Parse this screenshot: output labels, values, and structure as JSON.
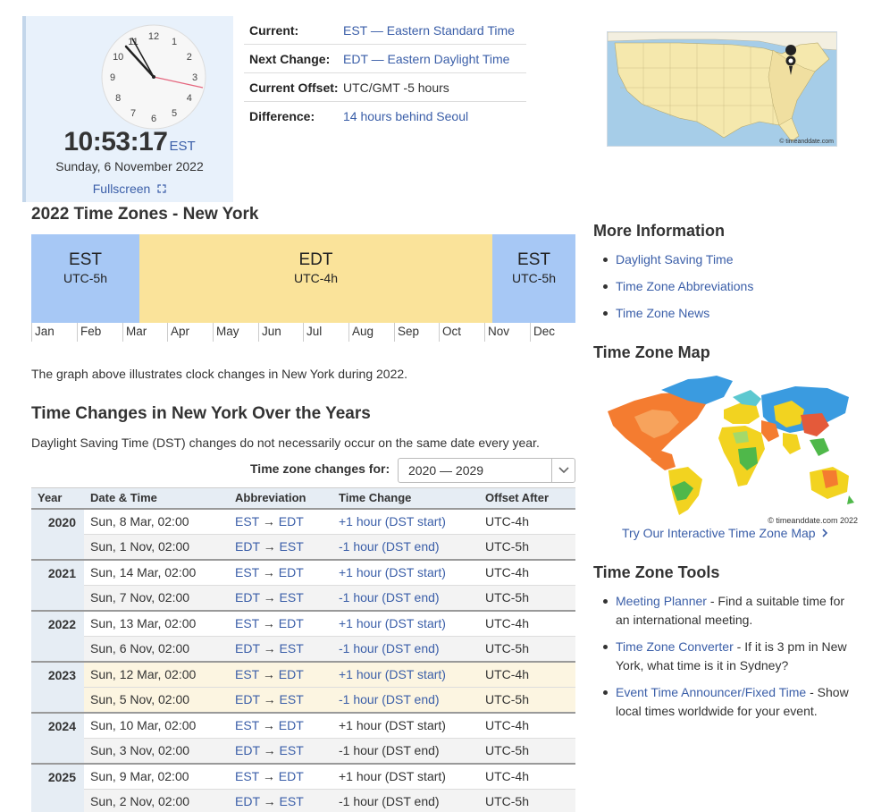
{
  "clock": {
    "time": "10:53:17",
    "zone": "EST",
    "date": "Sunday, 6 November 2022",
    "fullscreen_label": "Fullscreen",
    "numerals": [
      "12",
      "1",
      "2",
      "3",
      "4",
      "5",
      "6",
      "7",
      "8",
      "9",
      "10",
      "11"
    ]
  },
  "info": {
    "rows": [
      {
        "label": "Current:",
        "value": "EST — Eastern Standard Time"
      },
      {
        "label": "Next Change:",
        "value": "EDT — Eastern Daylight Time"
      },
      {
        "label": "Current Offset:",
        "value": "UTC/GMT -5 hours"
      },
      {
        "label": "Difference:",
        "value": "14 hours behind Seoul"
      }
    ]
  },
  "small_map": {
    "copyright": "© timeanddate.com"
  },
  "timezones": {
    "heading": "2022 Time Zones - New York",
    "blocks": [
      {
        "abbr": "EST",
        "offset": "UTC-5h"
      },
      {
        "abbr": "EDT",
        "offset": "UTC-4h"
      },
      {
        "abbr": "EST",
        "offset": "UTC-5h"
      }
    ],
    "months": [
      "Jan",
      "Feb",
      "Mar",
      "Apr",
      "May",
      "Jun",
      "Jul",
      "Aug",
      "Sep",
      "Oct",
      "Nov",
      "Dec"
    ],
    "note": "The graph above illustrates clock changes in New York during 2022."
  },
  "changes": {
    "heading": "Time Changes in New York Over the Years",
    "note": "Daylight Saving Time (DST) changes do not necessarily occur on the same date every year.",
    "select_label": "Time zone changes for:",
    "select_value": "2020 — 2029",
    "columns": [
      "Year",
      "Date & Time",
      "Abbreviation",
      "Time Change",
      "Offset After"
    ],
    "rows": [
      {
        "year": "2020",
        "date": "Sun, 8 Mar, 02:00",
        "from": "EST",
        "to": "EDT",
        "change": "+1 hour (DST start)",
        "offset": "UTC-4h"
      },
      {
        "year": "",
        "date": "Sun, 1 Nov, 02:00",
        "from": "EDT",
        "to": "EST",
        "change": "-1 hour (DST end)",
        "offset": "UTC-5h"
      },
      {
        "year": "2021",
        "date": "Sun, 14 Mar, 02:00",
        "from": "EST",
        "to": "EDT",
        "change": "+1 hour (DST start)",
        "offset": "UTC-4h"
      },
      {
        "year": "",
        "date": "Sun, 7 Nov, 02:00",
        "from": "EDT",
        "to": "EST",
        "change": "-1 hour (DST end)",
        "offset": "UTC-5h"
      },
      {
        "year": "2022",
        "date": "Sun, 13 Mar, 02:00",
        "from": "EST",
        "to": "EDT",
        "change": "+1 hour (DST start)",
        "offset": "UTC-4h"
      },
      {
        "year": "",
        "date": "Sun, 6 Nov, 02:00",
        "from": "EDT",
        "to": "EST",
        "change": "-1 hour (DST end)",
        "offset": "UTC-5h"
      },
      {
        "year": "2023",
        "date": "Sun, 12 Mar, 02:00",
        "from": "EST",
        "to": "EDT",
        "change": "+1 hour (DST start)",
        "offset": "UTC-4h"
      },
      {
        "year": "",
        "date": "Sun, 5 Nov, 02:00",
        "from": "EDT",
        "to": "EST",
        "change": "-1 hour (DST end)",
        "offset": "UTC-5h"
      },
      {
        "year": "2024",
        "date": "Sun, 10 Mar, 02:00",
        "from": "EST",
        "to": "EDT",
        "change": "+1 hour (DST start)",
        "offset": "UTC-4h"
      },
      {
        "year": "",
        "date": "Sun, 3 Nov, 02:00",
        "from": "EDT",
        "to": "EST",
        "change": "-1 hour (DST end)",
        "offset": "UTC-5h"
      },
      {
        "year": "2025",
        "date": "Sun, 9 Mar, 02:00",
        "from": "EST",
        "to": "EDT",
        "change": "+1 hour (DST start)",
        "offset": "UTC-4h"
      },
      {
        "year": "",
        "date": "Sun, 2 Nov, 02:00",
        "from": "EDT",
        "to": "EST",
        "change": "-1 hour (DST end)",
        "offset": "UTC-5h"
      }
    ]
  },
  "sidebar": {
    "more_heading": "More Information",
    "more_links": [
      "Daylight Saving Time",
      "Time Zone Abbreviations",
      "Time Zone News"
    ],
    "map_heading": "Time Zone Map",
    "map_copyright": "© timeanddate.com 2022",
    "map_link": "Try Our Interactive Time Zone Map",
    "tools_heading": "Time Zone Tools",
    "tools": [
      {
        "link": "Meeting Planner",
        "text": " - Find a suitable time for an international meeting."
      },
      {
        "link": "Time Zone Converter",
        "text": " - If it is 3 pm in New York, what time is it in Sydney?"
      },
      {
        "link": "Event Time Announcer/Fixed Time",
        "text": " - Show local times worldwide for your event."
      }
    ]
  },
  "colors": {
    "est": "#a7c8f5",
    "edt": "#fae39a",
    "link": "#3a5ea8",
    "panel": "#e8f1fb"
  }
}
